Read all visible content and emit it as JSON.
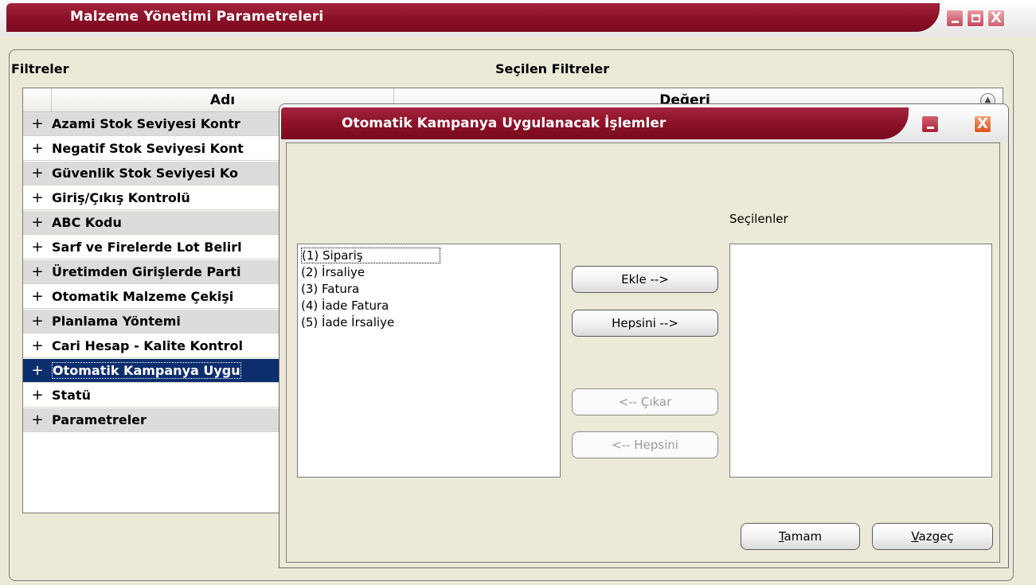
{
  "main_window": {
    "title": "Malzeme Yönetimi Parametreleri",
    "min_glyph": "",
    "close_glyph": "X",
    "filters_label": "Filtreler",
    "selected_filters_label": "Seçilen Filtreler"
  },
  "grid": {
    "headers": {
      "name": "Adı",
      "value": "Değeri"
    },
    "expand_symbol": "+",
    "rows": [
      {
        "label": "Azami Stok Seviyesi Kontr"
      },
      {
        "label": "Negatif Stok Seviyesi Kont"
      },
      {
        "label": "Güvenlik Stok Seviyesi Ko"
      },
      {
        "label": "Giriş/Çıkış Kontrolü"
      },
      {
        "label": "ABC Kodu"
      },
      {
        "label": "Sarf ve Firelerde Lot Belirl"
      },
      {
        "label": "Üretimden Girişlerde Parti"
      },
      {
        "label": "Otomatik Malzeme Çekişi"
      },
      {
        "label": "Planlama Yöntemi"
      },
      {
        "label": "Cari Hesap - Kalite Kontrol"
      },
      {
        "label": "Otomatik Kampanya Uygu"
      },
      {
        "label": "Statü"
      },
      {
        "label": "Parametreler"
      }
    ],
    "selected_row_index": 10
  },
  "dialog": {
    "title": "Otomatik Kampanya Uygulanacak İşlemler",
    "close_glyph": "X",
    "available_items": [
      "(1) Sipariş",
      "(2) İrsaliye",
      "(3) Fatura",
      "(4) İade Fatura",
      "(5) İade İrsaliye"
    ],
    "selected_caption": "Seçilenler",
    "buttons": {
      "add": "Ekle -->",
      "add_all": "Hepsini -->",
      "remove": "<-- Çıkar",
      "remove_all": "<-- Hepsini",
      "ok_mnemonic": "T",
      "ok_rest": "amam",
      "cancel_mnemonic": "V",
      "cancel_rest": "azgeç"
    }
  },
  "colors": {
    "title_accent": "#8c1128",
    "selection": "#0c2e6e",
    "window_bg": "#ece9d8"
  }
}
